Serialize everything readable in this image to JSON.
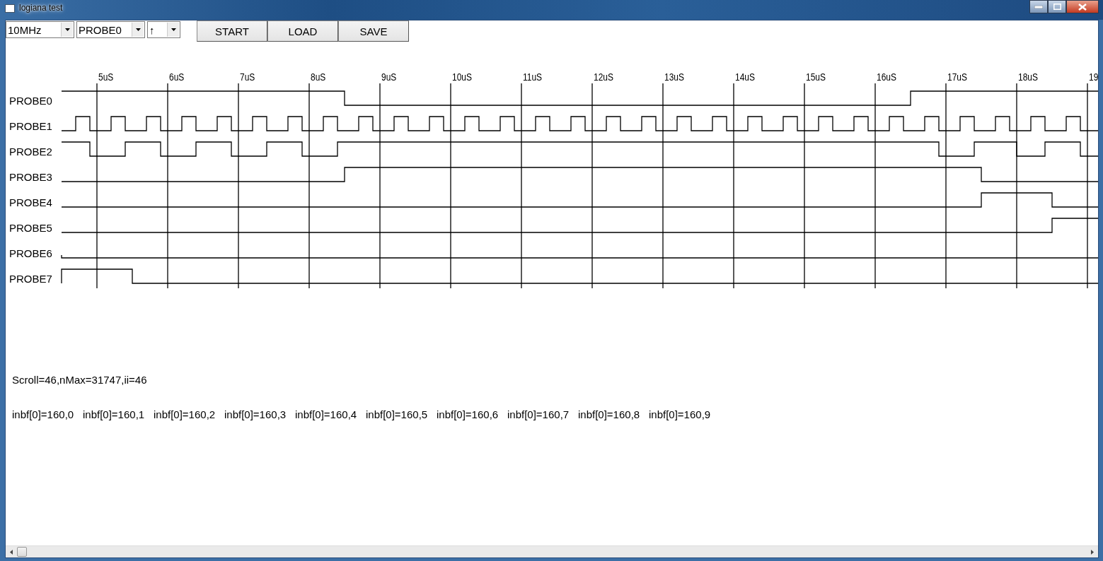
{
  "window": {
    "title": "logiana test"
  },
  "toolbar": {
    "dropdowns": [
      {
        "value": "10MHz"
      },
      {
        "value": "PROBE0"
      },
      {
        "value": "↑"
      }
    ],
    "buttons": [
      "START",
      "LOAD",
      "SAVE"
    ]
  },
  "timeline": {
    "ticks": [
      "5uS",
      "6uS",
      "7uS",
      "8uS",
      "9uS",
      "10uS",
      "11uS",
      "12uS",
      "13uS",
      "14uS",
      "15uS",
      "16uS",
      "17uS",
      "18uS",
      "19"
    ],
    "probes": [
      "PROBE0",
      "PROBE1",
      "PROBE2",
      "PROBE3",
      "PROBE4",
      "PROBE5",
      "PROBE6",
      "PROBE7"
    ]
  },
  "status": {
    "scroll_line": "Scroll=46,nMax=31747,ii=46",
    "inbf_values": [
      "inbf[0]=160,0",
      "inbf[0]=160,1",
      "inbf[0]=160,2",
      "inbf[0]=160,3",
      "inbf[0]=160,4",
      "inbf[0]=160,5",
      "inbf[0]=160,6",
      "inbf[0]=160,7",
      "inbf[0]=160,8",
      "inbf[0]=160,9"
    ]
  }
}
